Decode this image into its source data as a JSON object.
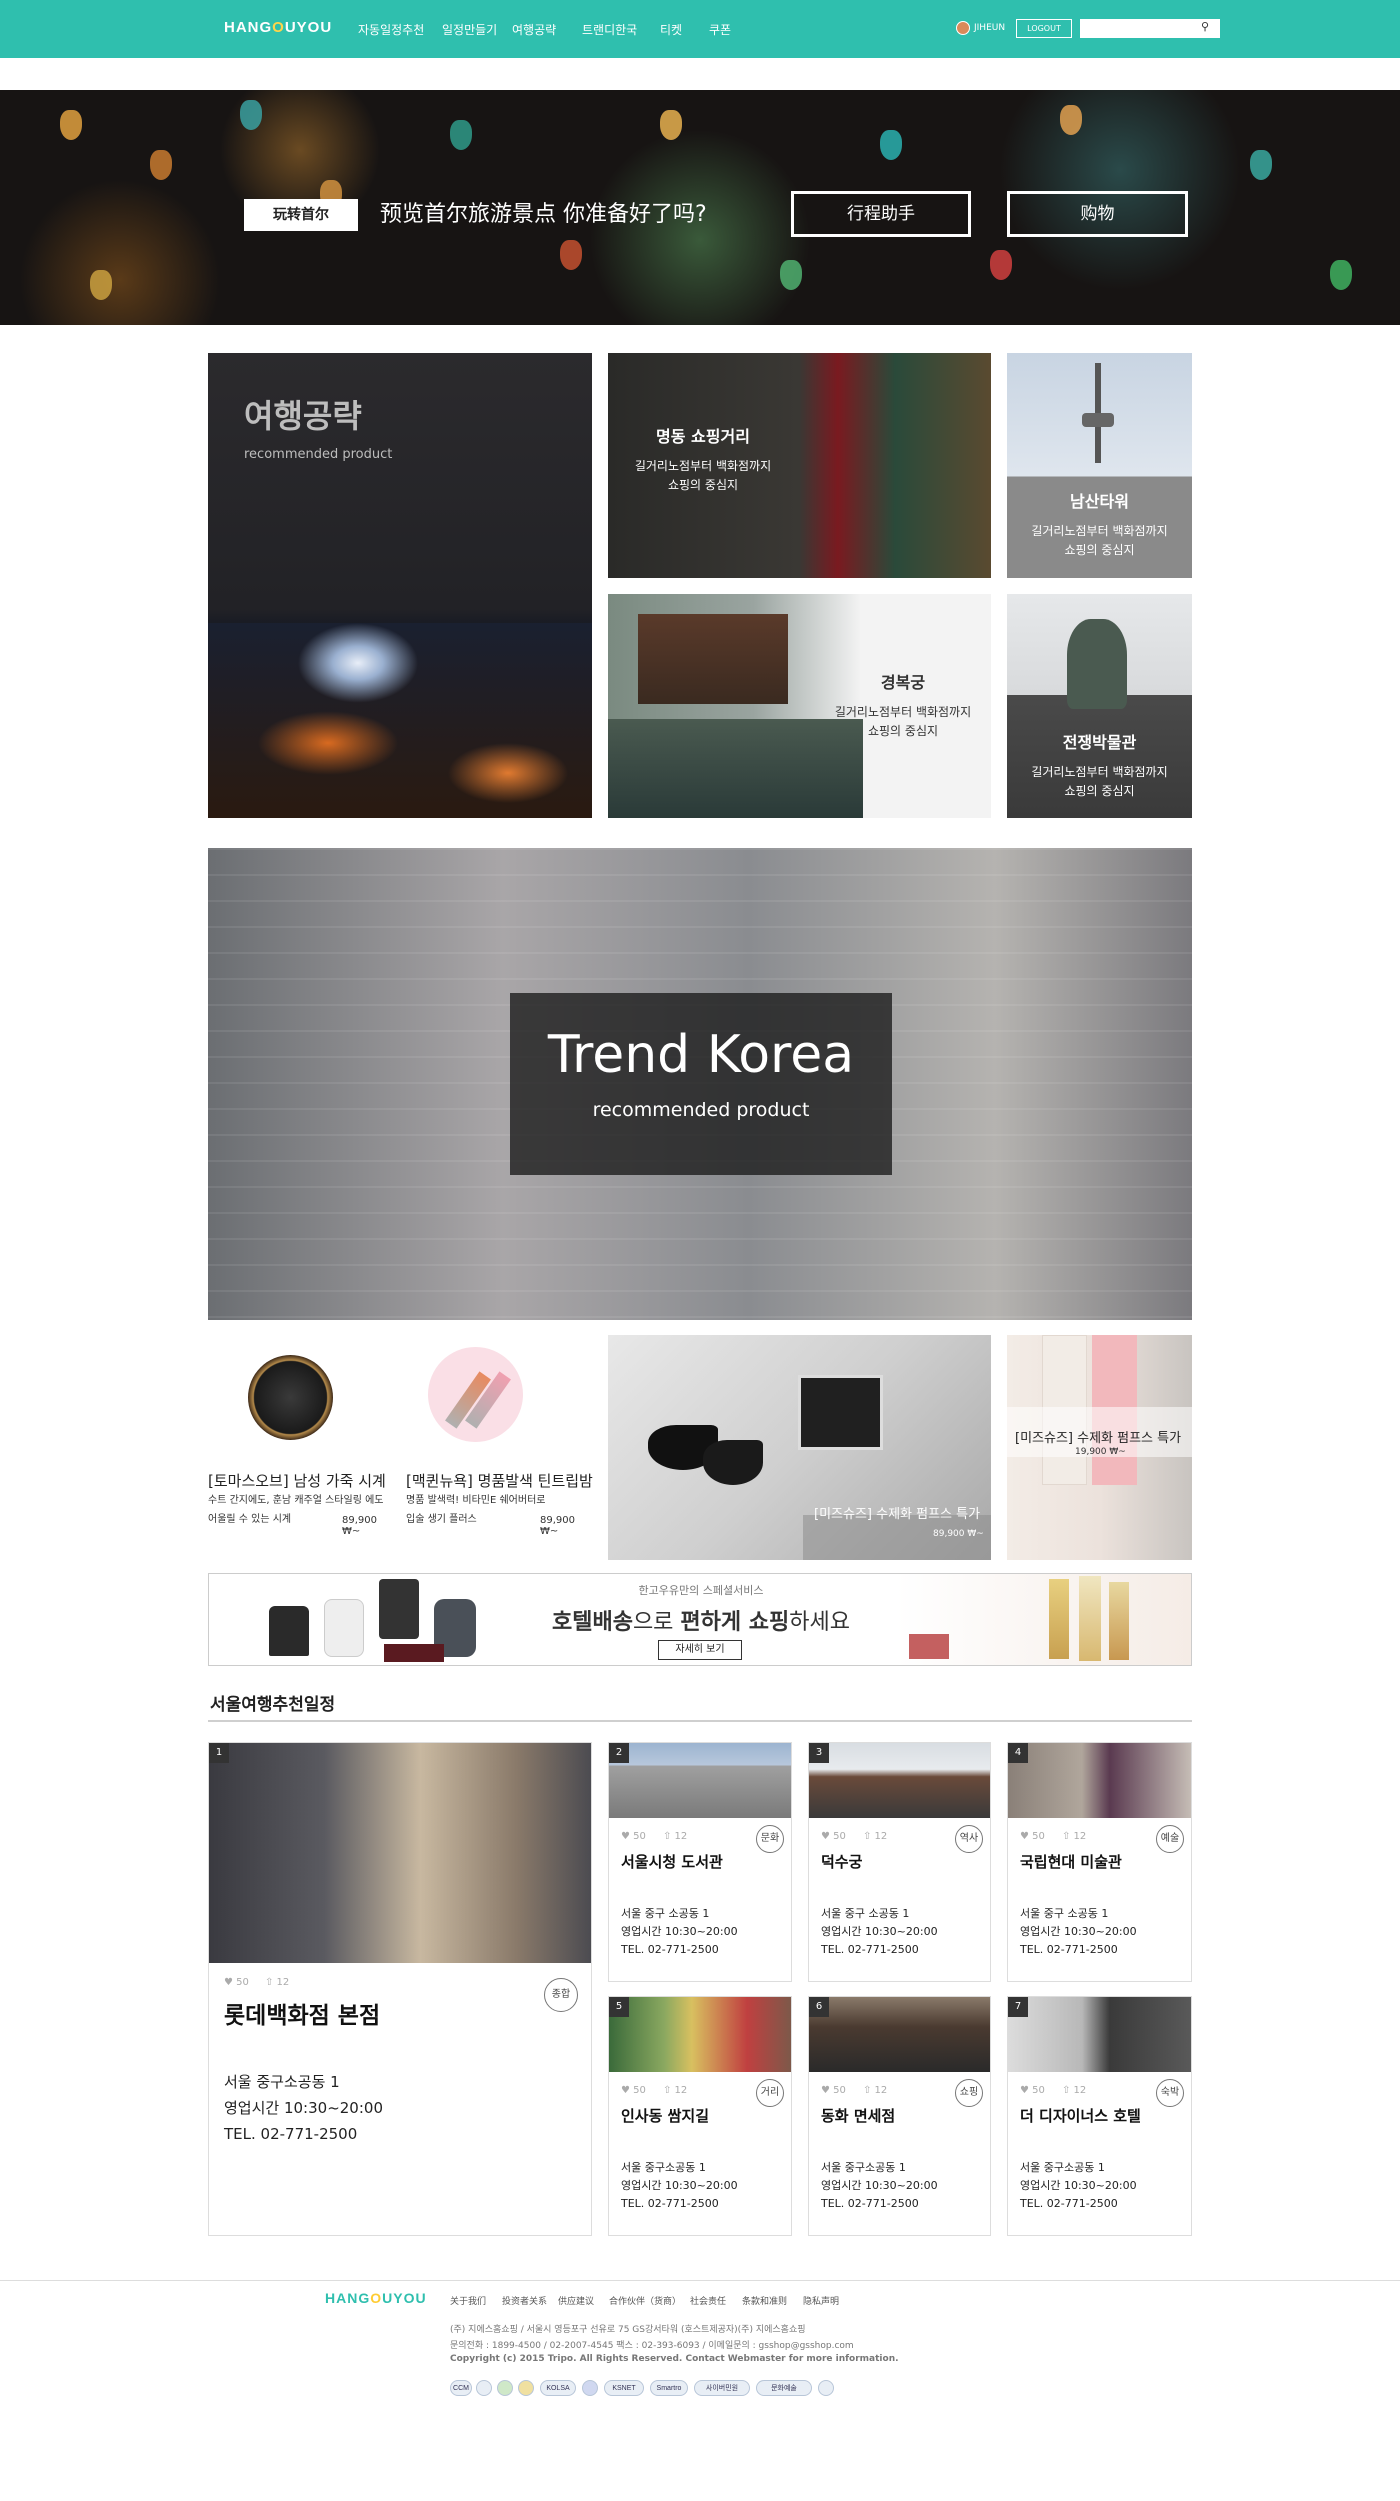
{
  "header": {
    "logo": "HANGOUYOU",
    "nav": [
      "자동일정추천",
      "일정만들기",
      "여행공략",
      "트랜디한국",
      "티켓",
      "쿠폰"
    ],
    "user": "JIHEUN",
    "logout": "LOGOUT",
    "search_placeholder": "",
    "brand_color": "#2fbfae"
  },
  "hero": {
    "tag": "玩转首尔",
    "title": "预览首尔旅游景点 你准备好了吗?",
    "buttons": [
      "行程助手",
      "购物"
    ]
  },
  "travel": {
    "main_title": "여행공략",
    "main_sub": "recommended product",
    "tiles": [
      {
        "title": "명동 쇼핑거리",
        "desc": [
          "길거리노점부터 백화점까지",
          "쇼핑의 중심지"
        ]
      },
      {
        "title": "남산타워",
        "desc": [
          "길거리노점부터 백화점까지",
          "쇼핑의 중심지"
        ]
      },
      {
        "title": "경복궁",
        "desc": [
          "길거리노점부터 백화점까지",
          "쇼핑의 중심지"
        ]
      },
      {
        "title": "전쟁박물관",
        "desc": [
          "길거리노점부터 백화점까지",
          "쇼핑의 중심지"
        ]
      }
    ]
  },
  "trend": {
    "title": "Trend Korea",
    "sub": "recommended product"
  },
  "products": [
    {
      "name": "[토마스오브] 남성 가죽 시계",
      "desc": [
        "수트 간지에도, 훈남 캐주얼 스타일링 에도",
        "어울릴 수 있는 시계"
      ],
      "price": "89,900 ₩~"
    },
    {
      "name": "[맥퀸뉴욕] 명품발색 틴트립밤",
      "desc": [
        "명품 발색력! 비타민E 쉐어버터로",
        "입술 생기 플러스"
      ],
      "price": "89,900 ₩~"
    },
    {
      "name": "[미즈슈즈] 수제화 펌프스 특가",
      "price": "89,900 ₩~"
    },
    {
      "name": "[미즈슈즈] 수제화 펌프스 특가",
      "price": "19,900 ₩~"
    }
  ],
  "hotel": {
    "small": "한고우유만의 스페셜서비스",
    "big_a": "호텔배송",
    "big_b": "으로 ",
    "big_c": "편하게 쇼핑",
    "big_d": "하세요",
    "button": "자세히 보기"
  },
  "schedule": {
    "title": "서울여행추천일정",
    "cards": [
      {
        "num": "1",
        "likes": "♥ 50",
        "shares": "⇧ 12",
        "cat": "종합",
        "name": "롯데백화점 본점",
        "addr": "서울 중구소공동 1",
        "hours": "영업시간 10:30~20:00",
        "tel": "TEL. 02-771-2500"
      },
      {
        "num": "2",
        "likes": "♥ 50",
        "shares": "⇧ 12",
        "cat": "문화",
        "name": "서울시청 도서관",
        "addr": "서울 중구 소공동 1",
        "hours": "영업시간 10:30~20:00",
        "tel": "TEL. 02-771-2500"
      },
      {
        "num": "3",
        "likes": "♥ 50",
        "shares": "⇧ 12",
        "cat": "역사",
        "name": "덕수궁",
        "addr": "서울 중구 소공동 1",
        "hours": "영업시간 10:30~20:00",
        "tel": "TEL. 02-771-2500"
      },
      {
        "num": "4",
        "likes": "♥ 50",
        "shares": "⇧ 12",
        "cat": "예술",
        "name": "국립현대 미술관",
        "addr": "서울 중구 소공동 1",
        "hours": "영업시간 10:30~20:00",
        "tel": "TEL. 02-771-2500"
      },
      {
        "num": "5",
        "likes": "♥ 50",
        "shares": "⇧ 12",
        "cat": "거리",
        "name": "인사동 쌈지길",
        "addr": "서울 중구소공동 1",
        "hours": "영업시간 10:30~20:00",
        "tel": "TEL. 02-771-2500"
      },
      {
        "num": "6",
        "likes": "♥ 50",
        "shares": "⇧ 12",
        "cat": "쇼핑",
        "name": "동화 면세점",
        "addr": "서울 중구소공동 1",
        "hours": "영업시간 10:30~20:00",
        "tel": "TEL. 02-771-2500"
      },
      {
        "num": "7",
        "likes": "♥ 50",
        "shares": "⇧ 12",
        "cat": "숙박",
        "name": "더 디자이너스 호텔",
        "addr": "서울 중구소공동 1",
        "hours": "영업시간 10:30~20:00",
        "tel": "TEL. 02-771-2500"
      }
    ]
  },
  "footer": {
    "logo": "HANGOUYOU",
    "links": [
      "关于我们",
      "投资者关系",
      "供应建议",
      "合作伙伴（货商）",
      "社会责任",
      "条款和准则",
      "隐私声明"
    ],
    "info": [
      "(주) 지에스홈쇼핑 / 서울시 영등포구 선유로 75 GS강서타워 (호스트제공자)(주) 지에스홈쇼핑",
      "문의전화 : 1899-4500 / 02-2007-4545 팩스 : 02-393-6093 / 이메일문의 : gsshop@gsshop.com",
      "Copyright (c) 2015 Tripo. All Rights Reserved. Contact Webmaster for more information."
    ],
    "certs": [
      "CCM",
      "",
      "",
      "",
      "KOLSA",
      "",
      "KSNET",
      "Smartro",
      "사이버민원",
      "문화예술",
      ""
    ]
  }
}
